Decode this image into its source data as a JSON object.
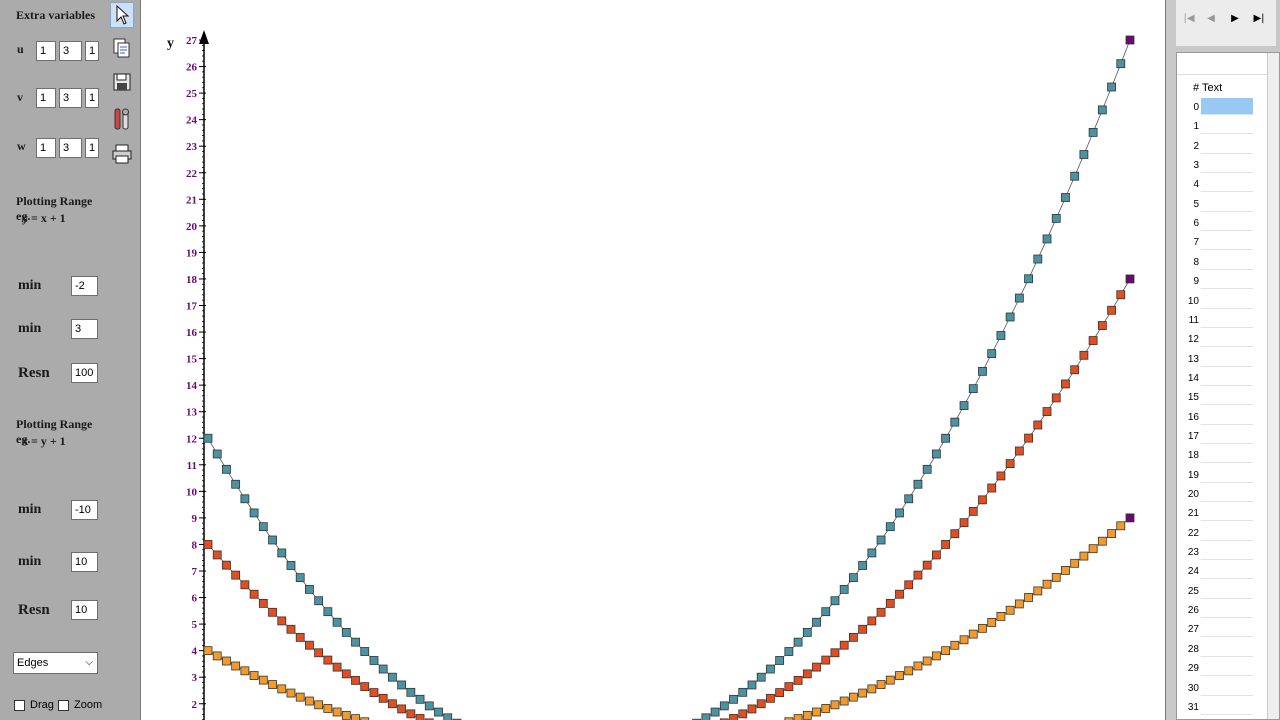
{
  "left_panel": {
    "extra_variables_title": "Extra variables",
    "variables": [
      {
        "name": "u",
        "values": [
          "1",
          "3",
          "1"
        ]
      },
      {
        "name": "v",
        "values": [
          "1",
          "3",
          "1"
        ]
      },
      {
        "name": "w",
        "values": [
          "1",
          "3",
          "1"
        ]
      }
    ],
    "range_y": {
      "title_line1": "Plotting Range eg.",
      "title_line2": "y = x + 1",
      "min_label": "min",
      "min_value": "-2",
      "max_label": "min",
      "max_value": "3",
      "resn_label": "Resn",
      "resn_value": "100"
    },
    "range_x": {
      "title_line1": "Plotting Range eg.",
      "title_line2": "x = y + 1",
      "min_label": "min",
      "min_value": "-10",
      "max_label": "min",
      "max_value": "10",
      "resn_label": "Resn",
      "resn_value": "10"
    },
    "mode_select": "Edges",
    "drag_label": "Drag",
    "zoom_label": "Zoom"
  },
  "toolbar": {
    "tools": [
      "pointer-icon",
      "copy-icon",
      "save-icon",
      "tools-icon",
      "print-icon"
    ]
  },
  "right_panel": {
    "header_hash": "#",
    "header_text": "Text",
    "rows": [
      "0",
      "1",
      "2",
      "3",
      "4",
      "5",
      "6",
      "7",
      "8",
      "9",
      "10",
      "11",
      "12",
      "13",
      "14",
      "15",
      "16",
      "17",
      "18",
      "19",
      "20",
      "21",
      "22",
      "23",
      "24",
      "25",
      "26",
      "27",
      "28",
      "29",
      "30",
      "31"
    ]
  },
  "chart_data": {
    "type": "scatter",
    "ylabel": "y",
    "y_ticks": [
      2,
      3,
      4,
      5,
      6,
      7,
      8,
      9,
      10,
      11,
      12,
      13,
      14,
      15,
      16,
      17,
      18,
      19,
      20,
      21,
      22,
      23,
      24,
      25,
      26,
      27
    ],
    "visible_ylim": [
      1.4,
      27.3
    ],
    "x_range": [
      -2,
      3
    ],
    "colors": {
      "teal": "#4b93a3",
      "red": "#e04e22",
      "orange": "#f39a2c",
      "endpoint": "#6a0a70",
      "tick_label": "#6a0a70"
    },
    "series": [
      {
        "formula_coeff": 3,
        "color": "teal",
        "y_at_x_min": 12,
        "y_at_x_max": 27
      },
      {
        "formula_coeff": 2,
        "color": "red",
        "y_at_x_min": 8,
        "y_at_x_max": 18
      },
      {
        "formula_coeff": 1,
        "color": "orange",
        "y_at_x_min": 4,
        "y_at_x_max": 9
      }
    ]
  }
}
